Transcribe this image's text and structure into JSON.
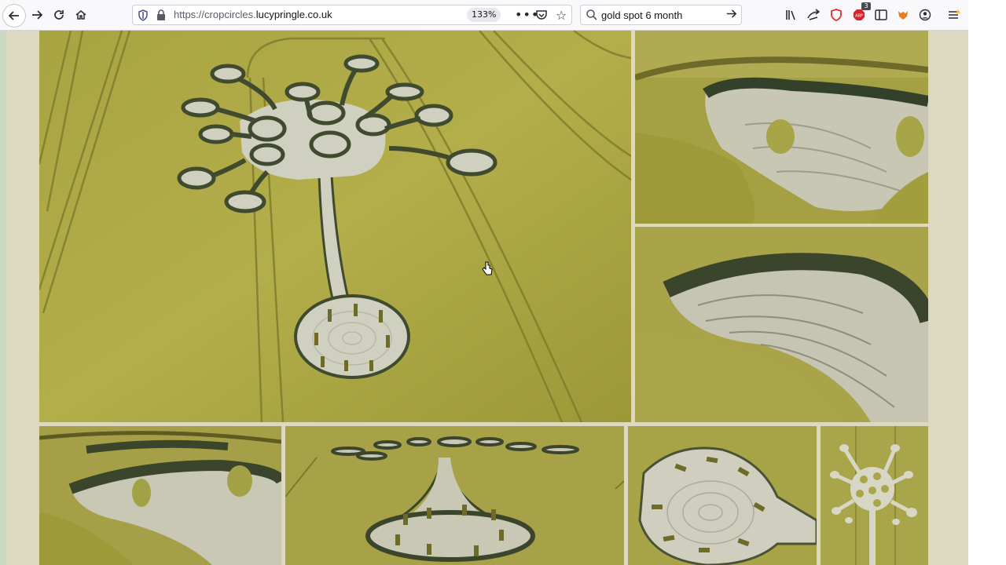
{
  "browser": {
    "url": {
      "scheme": "https://",
      "subdomain": "cropcircles.",
      "host": "lucypringle.co.uk"
    },
    "zoom": "133%",
    "search_query": "gold spot 6 month",
    "abp_badge_count": "3",
    "icons": {
      "back": "arrow-left-icon",
      "forward": "arrow-right-icon",
      "reload": "reload-icon",
      "home": "home-icon",
      "tracking": "shield-icon",
      "lock": "lock-icon",
      "page_actions": "more-dots-icon",
      "pocket": "pocket-icon",
      "bookmark": "star-icon",
      "search": "search-icon",
      "go": "arrow-right-icon",
      "library": "library-icon",
      "sync": "sync-icon",
      "brave": "brave-shield-icon",
      "adblock": "adblock-icon",
      "sidebar": "sidebar-icon",
      "extension": "extension-icon",
      "account": "account-icon",
      "menu": "hamburger-icon"
    }
  },
  "gallery": {
    "photos": [
      {
        "id": "main",
        "subject": "crop-circle-aerial-tree-formation"
      },
      {
        "id": "tr1",
        "subject": "crop-circle-ground-closeup"
      },
      {
        "id": "tr2",
        "subject": "crop-circle-swirl-closeup"
      },
      {
        "id": "b1",
        "subject": "crop-circle-ground-swirl"
      },
      {
        "id": "b2",
        "subject": "crop-circle-aerial-low-angle"
      },
      {
        "id": "b3",
        "subject": "crop-circle-pod-closeup"
      },
      {
        "id": "b4",
        "subject": "crop-circle-overhead"
      }
    ]
  },
  "colors": {
    "field": "#a8a33f",
    "field_dark": "#8e8a30",
    "flattened": "#cfd0bf",
    "shadow": "#3f4a2f",
    "page_bg": "#ddd9c1"
  }
}
